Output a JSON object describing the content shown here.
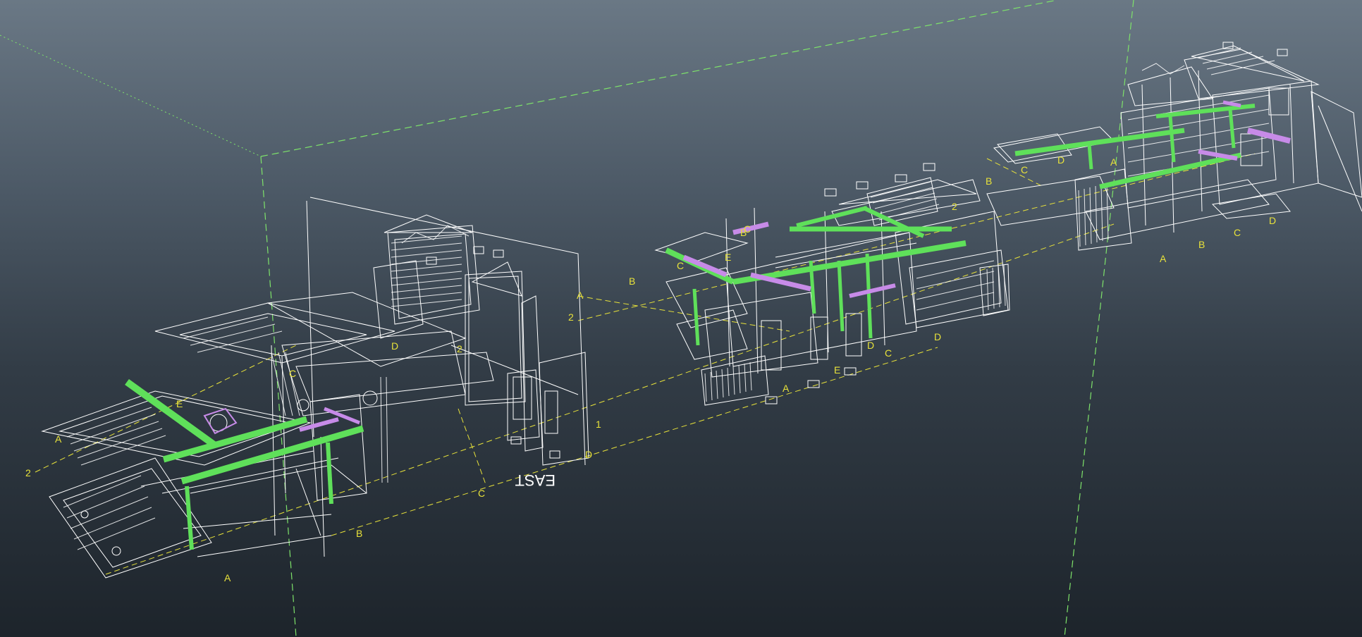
{
  "scene": {
    "description_colors": {
      "background_top": "#6a7885",
      "background_bottom": "#1d242b",
      "wireframe": "#ffffff",
      "gridline": "#e8e23a",
      "duct_green": "#5fe05a",
      "duct_purple": "#c78be8",
      "bounding_box": "#7ee36a"
    },
    "labels": {
      "east": "EAST",
      "left_model": {
        "a_top": "A",
        "two_left": "2",
        "d_mid": "D",
        "two_mid": "2",
        "c_upper": "C",
        "e_upper": "E",
        "c_lower": "C",
        "b_lower": "B",
        "a_lower": "A",
        "one_right": "1",
        "d_right": "D"
      },
      "middle_model": {
        "a_left": "A",
        "two_left": "2",
        "b_left": "B",
        "c_left": "C",
        "e_top": "E",
        "b_top": "B",
        "c_mid": "C",
        "d_right": "D",
        "c_bottom": "C",
        "e_bottom": "E",
        "a_bottom": "A",
        "d_bottom": "D"
      },
      "right_model": {
        "b_left": "B",
        "two_left": "2",
        "c_left": "C",
        "d_left": "D",
        "a_bottom": "A",
        "b_bottom": "B",
        "c_right": "C",
        "d_right": "D",
        "a_top": "A"
      }
    }
  }
}
